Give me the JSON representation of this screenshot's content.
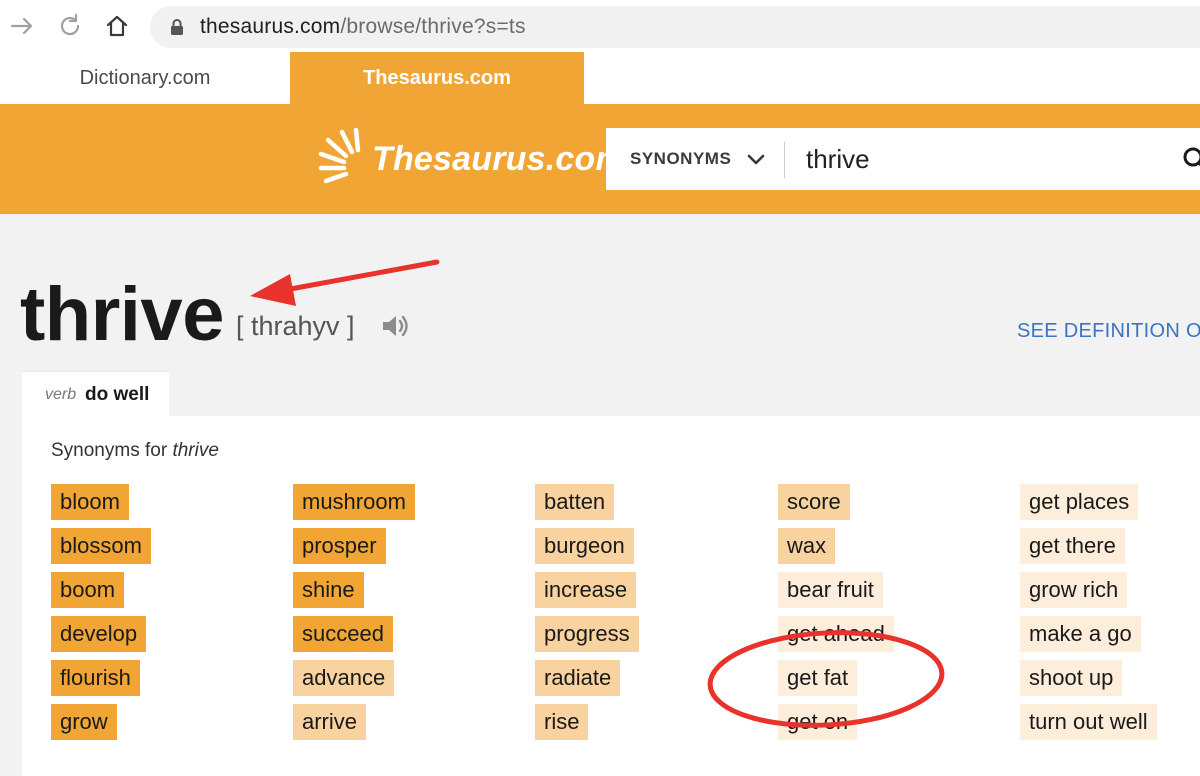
{
  "browser": {
    "url_host": "thesaurus.com",
    "url_path": "/browse/thrive?s=ts",
    "icons": [
      "forward-arrow-icon",
      "reload-icon",
      "home-icon",
      "lock-icon"
    ]
  },
  "site_tabs": {
    "dictionary": "Dictionary.com",
    "thesaurus": "Thesaurus.com"
  },
  "header": {
    "logo_text": "Thesaurus.com",
    "search_type": "SYNONYMS",
    "search_value": "thrive",
    "accent_color": "#f1a535"
  },
  "entry": {
    "word": "thrive",
    "pronunciation": "[ thrahyv ]",
    "see_definition": "SEE DEFINITION O"
  },
  "sense": {
    "pos": "verb",
    "definition": "do well"
  },
  "synonyms": {
    "heading_prefix": "Synonyms for ",
    "heading_word": "thrive",
    "relevance_colors": {
      "most": "#f1a535",
      "more": "#f8d29f",
      "less": "#fdeedb"
    },
    "columns": [
      [
        {
          "word": "bloom",
          "relevance": "most"
        },
        {
          "word": "blossom",
          "relevance": "most"
        },
        {
          "word": "boom",
          "relevance": "most"
        },
        {
          "word": "develop",
          "relevance": "most"
        },
        {
          "word": "flourish",
          "relevance": "most"
        },
        {
          "word": "grow",
          "relevance": "most"
        }
      ],
      [
        {
          "word": "mushroom",
          "relevance": "most"
        },
        {
          "word": "prosper",
          "relevance": "most"
        },
        {
          "word": "shine",
          "relevance": "most"
        },
        {
          "word": "succeed",
          "relevance": "most"
        },
        {
          "word": "advance",
          "relevance": "more"
        },
        {
          "word": "arrive",
          "relevance": "more"
        }
      ],
      [
        {
          "word": "batten",
          "relevance": "more"
        },
        {
          "word": "burgeon",
          "relevance": "more"
        },
        {
          "word": "increase",
          "relevance": "more"
        },
        {
          "word": "progress",
          "relevance": "more"
        },
        {
          "word": "radiate",
          "relevance": "more"
        },
        {
          "word": "rise",
          "relevance": "more"
        }
      ],
      [
        {
          "word": "score",
          "relevance": "more"
        },
        {
          "word": "wax",
          "relevance": "more"
        },
        {
          "word": "bear fruit",
          "relevance": "less"
        },
        {
          "word": "get ahead",
          "relevance": "less"
        },
        {
          "word": "get fat",
          "relevance": "less"
        },
        {
          "word": "get on",
          "relevance": "less"
        }
      ],
      [
        {
          "word": "get places",
          "relevance": "less"
        },
        {
          "word": "get there",
          "relevance": "less"
        },
        {
          "word": "grow rich",
          "relevance": "less"
        },
        {
          "word": "make a go",
          "relevance": "less"
        },
        {
          "word": "shoot up",
          "relevance": "less"
        },
        {
          "word": "turn out well",
          "relevance": "less"
        }
      ]
    ]
  },
  "annotations": {
    "color": "#e8322b",
    "arrow_target": "pronunciation",
    "circled_word": "get fat"
  }
}
